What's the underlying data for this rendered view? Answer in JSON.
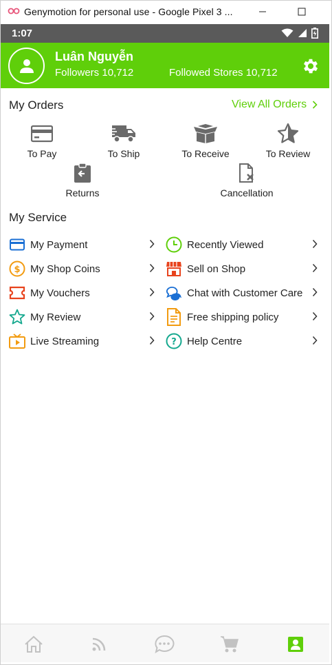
{
  "window": {
    "title": "Genymotion for personal use - Google Pixel 3 ..."
  },
  "status": {
    "time": "1:07"
  },
  "profile": {
    "name": "Luân Nguyễn",
    "followers": "Followers 10,712",
    "followed_stores": "Followed Stores 10,712"
  },
  "orders": {
    "title": "My Orders",
    "view_all": "View All Orders",
    "items": [
      {
        "label": "To Pay",
        "icon": "credit-card-icon"
      },
      {
        "label": "To Ship",
        "icon": "truck-icon"
      },
      {
        "label": "To Receive",
        "icon": "open-box-icon"
      },
      {
        "label": "To Review",
        "icon": "star-icon"
      },
      {
        "label": "Returns",
        "icon": "return-clipboard-icon"
      },
      {
        "label": "Cancellation",
        "icon": "cancel-document-icon"
      }
    ]
  },
  "service": {
    "title": "My Service",
    "left": [
      {
        "label": "My Payment",
        "icon": "payment-card-icon"
      },
      {
        "label": "My Shop Coins",
        "icon": "coin-icon"
      },
      {
        "label": "My Vouchers",
        "icon": "voucher-icon"
      },
      {
        "label": "My Review",
        "icon": "star-outline-icon"
      },
      {
        "label": "Live Streaming",
        "icon": "tv-icon"
      }
    ],
    "right": [
      {
        "label": "Recently Viewed",
        "icon": "clock-icon"
      },
      {
        "label": "Sell on Shop",
        "icon": "storefront-icon"
      },
      {
        "label": "Chat with Customer Care",
        "icon": "chat-bubbles-icon"
      },
      {
        "label": "Free shipping policy",
        "icon": "document-icon"
      },
      {
        "label": "Help Centre",
        "icon": "help-icon"
      }
    ]
  },
  "colors": {
    "accent": "#5fcf0a",
    "statusbar": "#5a5a5a"
  },
  "nav": {
    "items": [
      "home-icon",
      "feed-icon",
      "chat-icon",
      "cart-icon",
      "profile-icon"
    ],
    "active": "profile-icon"
  }
}
